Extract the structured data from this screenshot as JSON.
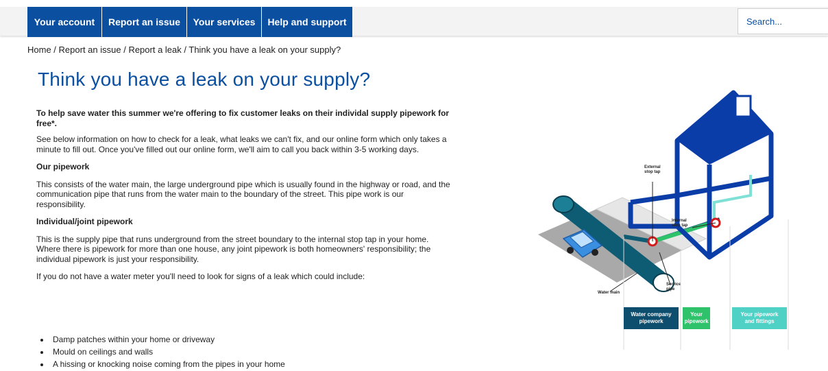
{
  "nav": {
    "items": [
      {
        "label": "Your account"
      },
      {
        "label": "Report an issue"
      },
      {
        "label": "Your services"
      },
      {
        "label": "Help and support"
      }
    ]
  },
  "search": {
    "placeholder": "Search..."
  },
  "breadcrumb": {
    "items": [
      "Home",
      "Report an issue",
      "Report a leak",
      "Think you have a leak on your supply?"
    ],
    "separator": " / "
  },
  "page": {
    "title": "Think you have a leak on your supply?",
    "intro_bold": "To help save water this summer we're offering to fix customer leaks on their individal supply pipework for free*.",
    "intro": "See below information on how to check for a leak, what leaks we can't fix, and our online form which only takes a minute to fill out. Once you've filled out our online form, we'll aim to call you back within 3-5 working days.",
    "our_pipework_heading": "Our pipework",
    "our_pipework_text": "This consists of the water main, the large underground pipe which is usually found in the highway or road, and the communication pipe that runs from the water main to the boundary of the street. This pipe work is our responsibility.",
    "individual_heading": "Individual/joint pipework",
    "individual_text": "This is the supply pipe that runs underground from the street boundary to the internal stop tap in your home. Where there is pipework for more than one house, any joint pipework is both homeowners' responsibility; the individual pipework is just your responsibility.",
    "no_meter_text": "If you do not have a water meter you'll need to look for signs of a leak which could include:",
    "signs": [
      "Damp patches within your home or driveway",
      "Mould on ceilings and walls",
      "A hissing or knocking noise coming from the pipes in your home"
    ]
  },
  "illustration": {
    "labels": {
      "external_stop_tap_1": "External",
      "external_stop_tap_2": "stop tap",
      "internal_stop_tap_1": "Internal",
      "internal_stop_tap_2": "stop tap",
      "service_pipe_1": "Service",
      "service_pipe_2": "pipe",
      "water_main": "Water main"
    },
    "legend": [
      {
        "line1": "Water company",
        "line2": "pipework",
        "color": "#0d4e6e"
      },
      {
        "line1": "Your",
        "line2": "pipework",
        "color": "#2ec36b"
      },
      {
        "line1": "Your pipework",
        "line2": "and fittings",
        "color": "#4fd1c5"
      }
    ],
    "colors": {
      "house": "#0b3da8",
      "main_pipe": "#0d5c73",
      "supply_pipe": "#2ec36b",
      "internal_pipe": "#7fe0d6",
      "road": "#a9a9a9",
      "car": "#3b8fe0"
    }
  }
}
